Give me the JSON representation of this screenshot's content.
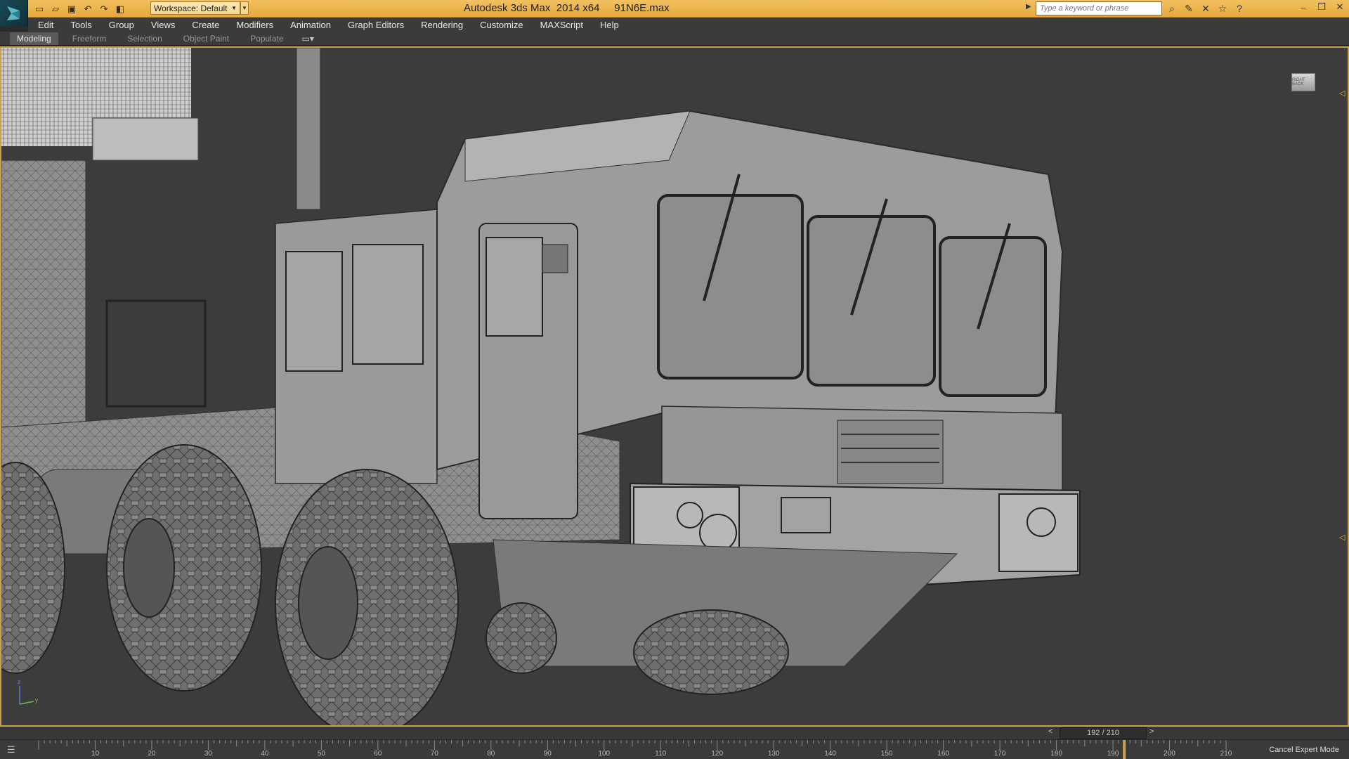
{
  "titlebar": {
    "workspace_label": "Workspace: Default",
    "title": "Autodesk 3ds Max  2014 x64     91N6E.max",
    "search_placeholder": "Type a keyword or phrase"
  },
  "menu": [
    "Edit",
    "Tools",
    "Group",
    "Views",
    "Create",
    "Modifiers",
    "Animation",
    "Graph Editors",
    "Rendering",
    "Customize",
    "MAXScript",
    "Help"
  ],
  "ribbon": {
    "tabs": [
      "Modeling",
      "Freeform",
      "Selection",
      "Object Paint",
      "Populate"
    ],
    "active_tab": "Modeling"
  },
  "viewport": {
    "viewcube_label": "RIGHT BACK",
    "axis_labels": [
      "z",
      "y"
    ]
  },
  "timeslider": {
    "frame": "192 / 210",
    "prev": "<",
    "next": ">"
  },
  "trackbar": {
    "ticks": [
      "10",
      "20",
      "30",
      "40",
      "50",
      "60",
      "70",
      "80",
      "90",
      "100",
      "110",
      "120",
      "130",
      "140",
      "150",
      "160",
      "170",
      "180",
      "190",
      "200",
      "210"
    ],
    "status": "Cancel Expert Mode"
  },
  "colors": {
    "titlebar": "#e6a93d",
    "viewport_border": "#c9a24b",
    "viewport_bg": "#3c3c3c"
  }
}
